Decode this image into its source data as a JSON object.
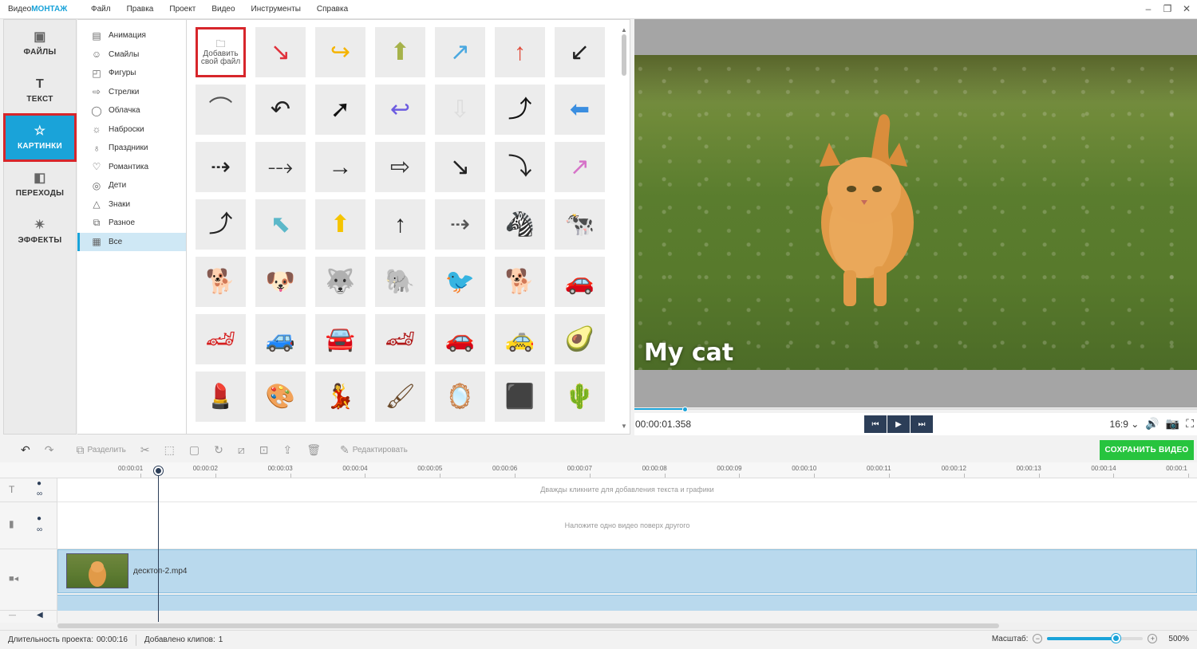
{
  "app": {
    "title_plain": "Видео",
    "title_accent": "МОНТАЖ"
  },
  "menu": [
    "Файл",
    "Правка",
    "Проект",
    "Видео",
    "Инструменты",
    "Справка"
  ],
  "window_controls": {
    "minimize": "‒",
    "restore": "❐",
    "close": "✕"
  },
  "leftnav": [
    {
      "label": "ФАЙЛЫ",
      "icon": "image-icon",
      "glyph": "▣",
      "active": false
    },
    {
      "label": "ТЕКСТ",
      "icon": "text-icon",
      "glyph": "T",
      "active": false
    },
    {
      "label": "КАРТИНКИ",
      "icon": "star-icon",
      "glyph": "☆",
      "active": true
    },
    {
      "label": "ПЕРЕХОДЫ",
      "icon": "transitions-icon",
      "glyph": "◧",
      "active": false
    },
    {
      "label": "ЭФФЕКТЫ",
      "icon": "magic-wand-icon",
      "glyph": "✴",
      "active": false
    }
  ],
  "categories": [
    {
      "label": "Анимация",
      "icon": "film-icon",
      "glyph": "▤"
    },
    {
      "label": "Смайлы",
      "icon": "smiley-icon",
      "glyph": "☺"
    },
    {
      "label": "Фигуры",
      "icon": "shapes-icon",
      "glyph": "◰"
    },
    {
      "label": "Стрелки",
      "icon": "arrow-icon",
      "glyph": "⇨"
    },
    {
      "label": "Облачка",
      "icon": "speech-bubble-icon",
      "glyph": "◯"
    },
    {
      "label": "Наброски",
      "icon": "sketch-icon",
      "glyph": "☼"
    },
    {
      "label": "Праздники",
      "icon": "balloon-icon",
      "glyph": "♁"
    },
    {
      "label": "Романтика",
      "icon": "heart-icon",
      "glyph": "♡"
    },
    {
      "label": "Дети",
      "icon": "toy-icon",
      "glyph": "◎"
    },
    {
      "label": "Знаки",
      "icon": "warning-icon",
      "glyph": "△"
    },
    {
      "label": "Разное",
      "icon": "misc-icon",
      "glyph": "⧉"
    },
    {
      "label": "Все",
      "icon": "grid-icon",
      "glyph": "▦",
      "active": true
    }
  ],
  "add_file": {
    "label_line1": "Добавить",
    "label_line2": "свой файл",
    "icon": "add-file-icon"
  },
  "grid_items": [
    {
      "name": "red-zigzag-arrow",
      "glyph": "↘",
      "color": "#e0303a"
    },
    {
      "name": "yellow-curved-arrow",
      "glyph": "↪",
      "color": "#f5b400"
    },
    {
      "name": "green-up-arrow",
      "glyph": "⬆",
      "color": "#a6b24a"
    },
    {
      "name": "blue-zigzag-arrow",
      "glyph": "↗",
      "color": "#4aa8e0"
    },
    {
      "name": "red-up-arrow",
      "glyph": "↑",
      "color": "#e04a3a"
    },
    {
      "name": "black-diagonal-arrow",
      "glyph": "↙",
      "color": "#222222"
    },
    {
      "name": "thin-curve",
      "glyph": "⌒",
      "color": "#555555"
    },
    {
      "name": "curved-back-arrow",
      "glyph": "↶",
      "color": "#222222"
    },
    {
      "name": "cursor-click",
      "glyph": "➚",
      "color": "#111111"
    },
    {
      "name": "purple-curved-arrow",
      "glyph": "↩",
      "color": "#6d5ce0"
    },
    {
      "name": "dotted-down-arrow",
      "glyph": "⇩",
      "color": "#dddddd"
    },
    {
      "name": "bold-curved-up-arrow",
      "glyph": "⤴",
      "color": "#111111"
    },
    {
      "name": "blue-left-arrow",
      "glyph": "⬅",
      "color": "#3a8ee0"
    },
    {
      "name": "dashed-right-arrow",
      "glyph": "⇢",
      "color": "#222222"
    },
    {
      "name": "dashed-curve-arrow",
      "glyph": "⤏",
      "color": "#333333"
    },
    {
      "name": "thin-right-arrow",
      "glyph": "→",
      "color": "#222222"
    },
    {
      "name": "outline-right-arrow",
      "glyph": "⇨",
      "color": "#333333"
    },
    {
      "name": "curved-down-right-arrow",
      "glyph": "↘",
      "color": "#222222"
    },
    {
      "name": "sweeping-arrow",
      "glyph": "⤵",
      "color": "#222222"
    },
    {
      "name": "pink-curved-arrow",
      "glyph": "↗",
      "color": "#d672c8"
    },
    {
      "name": "u-turn-arrow",
      "glyph": "⤴",
      "color": "#222222"
    },
    {
      "name": "teal-up-left-arrow",
      "glyph": "⬉",
      "color": "#5bb8c9"
    },
    {
      "name": "yellow-up-arrow",
      "glyph": "⬆",
      "color": "#f5c400"
    },
    {
      "name": "thin-up-arrow",
      "glyph": "↑",
      "color": "#222222"
    },
    {
      "name": "dotted-line-arrow",
      "glyph": "⇢",
      "color": "#555555"
    },
    {
      "name": "zebra",
      "glyph": "🦓",
      "color": "#333333"
    },
    {
      "name": "cow",
      "glyph": "🐄",
      "color": "#333333"
    },
    {
      "name": "collie-dog",
      "glyph": "🐕",
      "color": "#b0702a"
    },
    {
      "name": "dalmatian-puppy",
      "glyph": "🐶",
      "color": "#222222"
    },
    {
      "name": "husky-dog",
      "glyph": "🐺",
      "color": "#444444"
    },
    {
      "name": "elephant",
      "glyph": "🐘",
      "color": "#6b6b4a"
    },
    {
      "name": "purple-bird",
      "glyph": "🐦",
      "color": "#6d3aa8"
    },
    {
      "name": "cartoon-dog",
      "glyph": "🐕",
      "color": "#d0a020"
    },
    {
      "name": "orange-sports-car",
      "glyph": "🚗",
      "color": "#e85a2a"
    },
    {
      "name": "red-sports-car",
      "glyph": "🏎",
      "color": "#d62020"
    },
    {
      "name": "blue-cartoon-car",
      "glyph": "🚙",
      "color": "#3aa8e0"
    },
    {
      "name": "silver-car",
      "glyph": "🚘",
      "color": "#888888"
    },
    {
      "name": "red-race-car",
      "glyph": "🏎",
      "color": "#b01818"
    },
    {
      "name": "green-classic-car",
      "glyph": "🚗",
      "color": "#2a7a3a"
    },
    {
      "name": "yellow-taxi",
      "glyph": "🚕",
      "color": "#f2c420"
    },
    {
      "name": "avocado",
      "glyph": "🥑",
      "color": "#5a8a2a"
    },
    {
      "name": "lipsticks",
      "glyph": "💄",
      "color": "#c82040"
    },
    {
      "name": "eyeshadow-palette",
      "glyph": "🎨",
      "color": "#8a5ab0"
    },
    {
      "name": "redhead-woman",
      "glyph": "💃",
      "color": "#d0602a"
    },
    {
      "name": "makeup-brush",
      "glyph": "🖌",
      "color": "#6a4a2a"
    },
    {
      "name": "compact-powder",
      "glyph": "🪞",
      "color": "#777777"
    },
    {
      "name": "makeup-compact",
      "glyph": "⬛",
      "color": "#222222"
    },
    {
      "name": "cactus",
      "glyph": "🌵",
      "color": "#4a8a2a"
    }
  ],
  "preview": {
    "caption": "My cat",
    "timecode": "00:00:01.358",
    "aspect": "16:9",
    "aspect_chevron": "⌄",
    "progress": 0.09
  },
  "transport": {
    "prev": "⏮",
    "play": "▶",
    "next": "⏭"
  },
  "playback_icons": {
    "volume": "🔊",
    "snapshot": "📷",
    "fullscreen": "⛶"
  },
  "toolbar": {
    "undo": "↶",
    "redo": "↷",
    "split_label": "Разделить",
    "split_icon": "⧉",
    "cut": "✂",
    "crop": "⬚",
    "frame": "▢",
    "rotate": "↻",
    "zoom": "⧄",
    "stabilize": "⊡",
    "import": "⇪",
    "delete": "🗑",
    "edit_label": "Редактировать",
    "edit_icon": "✎",
    "save_label": "СОХРАНИТЬ ВИДЕО"
  },
  "ruler_ticks": [
    "00:00:01",
    "00:00:02",
    "00:00:03",
    "00:00:04",
    "00:00:05",
    "00:00:06",
    "00:00:07",
    "00:00:08",
    "00:00:09",
    "00:00:10",
    "00:00:11",
    "00:00:12",
    "00:00:13",
    "00:00:14",
    "00:00:1"
  ],
  "tracks": {
    "text_hint": "Дважды кликните для добавления текста и графики",
    "overlay_hint": "Наложите одно видео поверх другого",
    "clip_name": "десктоп-2.mp4",
    "text_icon": "T",
    "overlay_icon": "▮",
    "video_icon": "🎥",
    "audio_icon": "🔈",
    "eye_icon": "👁",
    "link_icon": "🔗",
    "minus_icon": "—"
  },
  "status": {
    "duration_label": "Длительность проекта:",
    "duration_value": "00:00:16",
    "clips_label": "Добавлено клипов:",
    "clips_value": "1",
    "zoom_label": "Масштаб:",
    "zoom_value": "500%",
    "zoom_level": 0.72,
    "zoom_minus": "−",
    "zoom_plus": "+"
  },
  "colors": {
    "accent": "#1aa3d9",
    "highlight": "#d7262b",
    "save": "#27c43e",
    "dark": "#2c3e58"
  }
}
